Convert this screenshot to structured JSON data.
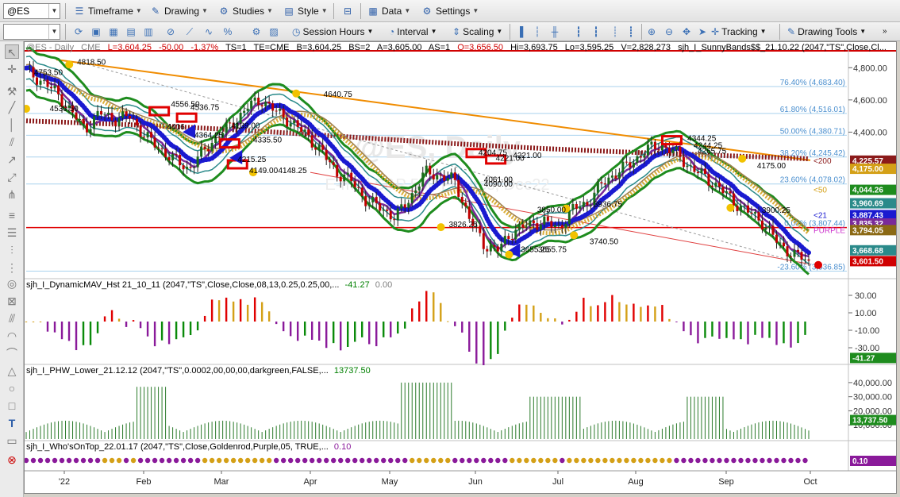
{
  "toolbar": {
    "symbol": "@ES",
    "timeframe": "Timeframe",
    "drawing": "Drawing",
    "studies": "Studies",
    "style": "Style",
    "data": "Data",
    "settings": "Settings",
    "session_hours": "Session Hours",
    "interval": "Interval",
    "scaling": "Scaling",
    "tracking": "Tracking",
    "drawing_tools": "Drawing Tools"
  },
  "header": {
    "symbol": "@ES - Daily",
    "exchange": "CME",
    "last": "L=3,604.25",
    "change": "-50.00",
    "pct": "-1.37%",
    "ts": "TS=1",
    "te": "TE=CME",
    "bid": "B=3,604.25",
    "bs": "BS=2",
    "ask": "A=3,605.00",
    "as": "AS=1",
    "open": "O=3,656.50",
    "high": "Hi=3,693.75",
    "low": "Lo=3,595.25",
    "volume": "V=2,828,273",
    "study": "sjh_I_SunnyBands$$_21.10.22 (2047,\"TS\",Close,Cl..."
  },
  "watermark": {
    "line1": "@ES, Daily",
    "line2": "E-mini S&P 500 Futures, Dec22"
  },
  "price_pane": {
    "y_ticks": [
      "4,800.00",
      "4,600.00",
      "4,400.00"
    ],
    "fib_levels": [
      {
        "label": "76.40% (4,683.40)",
        "value": 4683.4
      },
      {
        "label": "61.80% (4,516.01)",
        "value": 4516.01
      },
      {
        "label": "50.00% (4,380.71)",
        "value": 4380.71
      },
      {
        "label": "38.20% (4,245.42)",
        "value": 4245.42
      },
      {
        "label": "23.60% (4,078.02)",
        "value": 4078.02
      },
      {
        "label": "0.00% (3,807.44)",
        "value": 3807.44
      },
      {
        "label": "-23.60% (3,536.85)",
        "value": 3536.85
      }
    ],
    "price_tags": [
      {
        "text": "4,225.57",
        "bg": "#8b1a1a",
        "value": 4225.57
      },
      {
        "text": "4,175.00",
        "bg": "#d4a017",
        "value": 4175.0
      },
      {
        "text": "4,044.26",
        "bg": "#1e8c1e",
        "value": 4044.26
      },
      {
        "text": "3,960.69",
        "bg": "#2a8a8a",
        "value": 3960.69
      },
      {
        "text": "3,887.43",
        "bg": "#1a1ad0",
        "value": 3887.43
      },
      {
        "text": "3,835.32",
        "bg": "#7a2a9a",
        "value": 3835.32
      },
      {
        "text": "3,794.05",
        "bg": "#8b6914",
        "value": 3794.05
      },
      {
        "text": "3,668.68",
        "bg": "#2a8a8a",
        "value": 3668.68
      },
      {
        "text": "3,601.50",
        "bg": "#d00000",
        "value": 3601.5
      }
    ],
    "ma_labels": [
      {
        "text": "<200",
        "color": "#8b1a1a",
        "value": 4225.57
      },
      {
        "text": "<50",
        "color": "#d4a017",
        "value": 4044.26
      },
      {
        "text": "<21",
        "color": "#1a1ad0",
        "value": 3887.43
      },
      {
        "text": "PURPLE",
        "color": "#cc33cc",
        "value": 3794.05
      }
    ],
    "annotations": [
      {
        "text": "4818.50",
        "pdx": 0.065,
        "value": 4818.5
      },
      {
        "text": "4753.50",
        "pdx": 0.01,
        "value": 4753.5
      },
      {
        "text": "4530.50",
        "pdx": 0.03,
        "value": 4530.5
      },
      {
        "text": "4556.50",
        "pdx": 0.185,
        "value": 4556.5
      },
      {
        "text": "4536.75",
        "pdx": 0.21,
        "value": 4536.75
      },
      {
        "text": "4416",
        "pdx": 0.18,
        "value": 4416
      },
      {
        "text": "4364.25",
        "pdx": 0.215,
        "value": 4364.25
      },
      {
        "text": "4215.25",
        "pdx": 0.27,
        "value": 4215.25
      },
      {
        "text": "4335.50",
        "pdx": 0.29,
        "value": 4335.5
      },
      {
        "text": "4139.00",
        "pdx": 0.262,
        "value": 4425
      },
      {
        "text": "4149.00",
        "pdx": 0.285,
        "value": 4147
      },
      {
        "text": "4148.25",
        "pdx": 0.322,
        "value": 4147
      },
      {
        "text": "4640.75",
        "pdx": 0.38,
        "value": 4618
      },
      {
        "text": "4221.00",
        "pdx": 0.6,
        "value": 4222
      },
      {
        "text": "4204.75",
        "pdx": 0.578,
        "value": 4256
      },
      {
        "text": "4221.00",
        "pdx": 0.622,
        "value": 4240
      },
      {
        "text": "4090.00",
        "pdx": 0.585,
        "value": 4062
      },
      {
        "text": "4061.00",
        "pdx": 0.585,
        "value": 4088
      },
      {
        "text": "3826.25",
        "pdx": 0.54,
        "value": 3810
      },
      {
        "text": "3850.00",
        "pdx": 0.653,
        "value": 3902
      },
      {
        "text": "3936.75",
        "pdx": 0.725,
        "value": 3936.75
      },
      {
        "text": "3740.50",
        "pdx": 0.72,
        "value": 3705
      },
      {
        "text": "3655.25",
        "pdx": 0.632,
        "value": 3655.25
      },
      {
        "text": "3655.75",
        "pdx": 0.654,
        "value": 3655.75
      },
      {
        "text": "4344.25",
        "pdx": 0.845,
        "value": 4344.25
      },
      {
        "text": "4244.25",
        "pdx": 0.853,
        "value": 4300
      },
      {
        "text": "4265.75",
        "pdx": 0.858,
        "value": 4265.75
      },
      {
        "text": "4175.00",
        "pdx": 0.934,
        "value": 4175.0
      },
      {
        "text": "3900.25",
        "pdx": 0.94,
        "value": 3900.25
      }
    ]
  },
  "studies": {
    "dynamic_mav": {
      "label": "sjh_I_DynamicMAV_Hst 21_10_11 (2047,\"TS\",Close,Close,08,13,0.25,0.25,00,...",
      "value1": "-41.27",
      "value2": "0.00",
      "y_ticks": [
        "30.00",
        "10.00",
        "-10.00",
        "-30.00"
      ],
      "tag": "-41.27"
    },
    "phw_lower": {
      "label": "sjh_I_PHW_Lower_21.12.12 (2047,\"TS\",0.0002,00,00,00,darkgreen,FALSE,...",
      "value": "13737.50",
      "y_ticks": [
        "40,000.00",
        "30,000.00",
        "20,000.00",
        "10,000.00"
      ],
      "tag": "13,737.50"
    },
    "whos_on_top": {
      "label": "sjh_I_Who'sOnTop_22.01.17 (2047,\"TS\",Close,Goldenrod,Purple,05, TRUE,...",
      "value": "0.10",
      "tag": "0.10"
    }
  },
  "x_axis": {
    "labels": [
      "'22",
      "Feb",
      "Mar",
      "Apr",
      "May",
      "Jun",
      "Jul",
      "Aug",
      "Sep",
      "Oct"
    ]
  },
  "chart_data": {
    "type": "candlestick",
    "title": "@ES - Daily",
    "instrument": "E-mini S&P 500 Futures, Dec22",
    "ylim": [
      3500,
      4900
    ],
    "x_months": [
      "'22",
      "Feb",
      "Mar",
      "Apr",
      "May",
      "Jun",
      "Jul",
      "Aug",
      "Sep",
      "Oct"
    ],
    "close_path": [
      4780,
      4720,
      4650,
      4530,
      4420,
      4520,
      4480,
      4500,
      4380,
      4300,
      4230,
      4170,
      4280,
      4380,
      4450,
      4560,
      4600,
      4520,
      4460,
      4380,
      4280,
      4150,
      4100,
      3980,
      3930,
      3870,
      3990,
      4150,
      4130,
      4100,
      3870,
      3700,
      3670,
      3790,
      3820,
      3850,
      3800,
      3920,
      3960,
      4080,
      4150,
      4210,
      4290,
      4320,
      4270,
      4180,
      4120,
      4050,
      3960,
      3900,
      3830,
      3700,
      3640,
      3601
    ],
    "ma200": [
      4470,
      4360
    ],
    "ma200_end": 4225.57,
    "last_close": 3601.5,
    "horizontal_line": 3807.44,
    "trendline": [
      4850,
      4225
    ]
  },
  "colors": {
    "ma200": "#8b1a1a",
    "ma50": "#d4a017",
    "ma21": "#1a1ad0",
    "band_outer": "#1e8c1e",
    "band_inner": "#2a8a8a",
    "fib": "#4a8fcf",
    "hist_green": "#0a8a0a",
    "hist_purple": "#8a1a9a",
    "hist_gold": "#d4a017",
    "hist_red": "#e00000"
  }
}
